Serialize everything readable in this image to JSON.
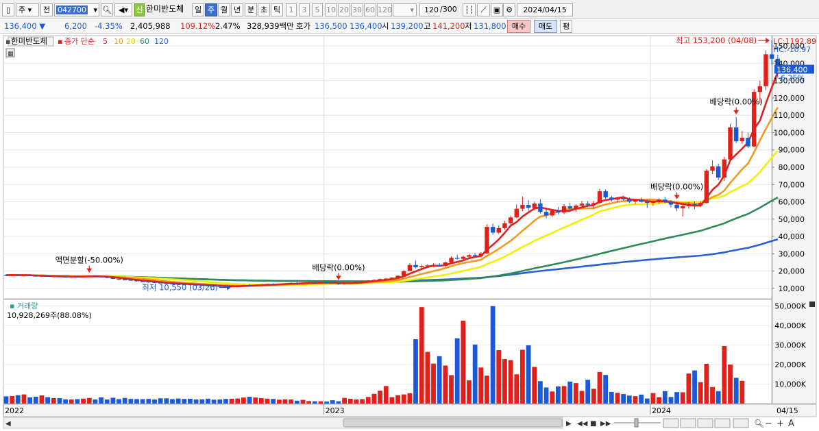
{
  "toolbar": {
    "market_label": "주",
    "prev_label": "전",
    "code": "042700",
    "badge": "신",
    "name": "한미반도체",
    "periods": [
      "일",
      "주",
      "월",
      "년",
      "분",
      "초",
      "틱"
    ],
    "active_period": "주",
    "intervals": [
      "1",
      "3",
      "5",
      "10",
      "20",
      "30",
      "60",
      "120"
    ],
    "count": "120",
    "count_total": "/300",
    "date": "2024/04/15"
  },
  "quote": {
    "price": "136,400",
    "change": "6,200",
    "change_pct": "-4.35%",
    "volume": "2,405,988",
    "volume_ratio": "109.12%",
    "turnover": "2.47%",
    "amount": "328,939백만",
    "ask_label": "호가",
    "ask1": "136,500",
    "ask2": "136,400",
    "open_label": "시",
    "open": "139,200",
    "high_label": "고",
    "high": "141,200",
    "low_label": "저",
    "low": "131,800",
    "buy_button": "매수",
    "sell_button": "매도",
    "eval_button": "평"
  },
  "colors": {
    "up": "#e0201b",
    "down": "#1a5ad8",
    "ma5": "#e0201b",
    "ma10": "#f19a22",
    "ma20": "#f0f000",
    "ma60": "#2e8b57",
    "ma120": "#2c5fd6"
  },
  "chart_data": {
    "type": "candlestick",
    "legend": {
      "title": "한미반도체",
      "ma_label": "종가 단순",
      "periods": [
        "5",
        "10",
        "20",
        "60",
        "120"
      ]
    },
    "lc_label": "LC:1192.89",
    "hc_label": "HC:-10.97",
    "y_ticks": [
      "150,000",
      "140,000",
      "130,000",
      "120,000",
      "110,000",
      "100,000",
      "90,000",
      "80,000",
      "70,000",
      "60,000",
      "50,000",
      "40,000",
      "30,000",
      "20,000",
      "10,000"
    ],
    "ylim": [
      4000,
      156000
    ],
    "current_price": "136,400",
    "current_pct": "-6.25%",
    "x_labels": [
      "2022",
      "2023",
      "2024"
    ],
    "x_last_label": "04/15",
    "annotations": [
      {
        "text": "액면분할(-50.00%)",
        "index": 14
      },
      {
        "text": "배당락(0.00%)",
        "index": 56
      },
      {
        "text": "배당락(0.00%)",
        "index": 113
      },
      {
        "text": "배당락(0.00%)",
        "index": 123
      }
    ],
    "high_note": "최고 153,200 (04/08)",
    "low_note": "최저 10,550 (03/26)",
    "candles": [
      [
        17800,
        18200,
        17100,
        17600
      ],
      [
        17600,
        18000,
        17000,
        17900
      ],
      [
        17900,
        18300,
        17200,
        17400
      ],
      [
        17400,
        17900,
        16900,
        17700
      ],
      [
        17700,
        18100,
        17100,
        17300
      ],
      [
        17300,
        17700,
        16600,
        16900
      ],
      [
        16900,
        17400,
        16500,
        17200
      ],
      [
        17200,
        17500,
        16700,
        16800
      ],
      [
        16800,
        17300,
        16400,
        17000
      ],
      [
        17000,
        17300,
        16500,
        16700
      ],
      [
        16700,
        17200,
        16300,
        16500
      ],
      [
        16500,
        17000,
        16100,
        16900
      ],
      [
        16900,
        17400,
        16400,
        16800
      ],
      [
        16800,
        17200,
        16300,
        17100
      ],
      [
        17100,
        17600,
        16700,
        17200
      ],
      [
        17200,
        17500,
        16600,
        16900
      ],
      [
        16900,
        17200,
        16200,
        16500
      ],
      [
        16500,
        16900,
        15800,
        16100
      ],
      [
        16100,
        16500,
        15300,
        15500
      ],
      [
        15500,
        15900,
        14900,
        15200
      ],
      [
        15200,
        15600,
        14600,
        14900
      ],
      [
        14900,
        15300,
        14400,
        14700
      ],
      [
        14700,
        15000,
        13900,
        14100
      ],
      [
        14100,
        14500,
        13600,
        13900
      ],
      [
        13900,
        14300,
        13300,
        13600
      ],
      [
        13600,
        14000,
        13000,
        13300
      ],
      [
        13300,
        13700,
        12700,
        13000
      ],
      [
        13000,
        13400,
        12500,
        12800
      ],
      [
        12800,
        13100,
        12300,
        12600
      ],
      [
        12600,
        13000,
        12100,
        12400
      ],
      [
        12400,
        12800,
        11900,
        12300
      ],
      [
        12300,
        12700,
        11800,
        12100
      ],
      [
        12100,
        12500,
        11600,
        11900
      ],
      [
        11900,
        12300,
        11400,
        11700
      ],
      [
        11700,
        12100,
        11200,
        11500
      ],
      [
        11500,
        11900,
        11000,
        11300
      ],
      [
        11300,
        11700,
        10800,
        11100
      ],
      [
        11100,
        11500,
        10600,
        10900
      ],
      [
        10900,
        11400,
        10550,
        11200
      ],
      [
        11200,
        11800,
        10900,
        11600
      ],
      [
        11600,
        12100,
        11200,
        11900
      ],
      [
        11900,
        12400,
        11400,
        11700
      ],
      [
        11700,
        12200,
        11200,
        12000
      ],
      [
        12000,
        12500,
        11600,
        12200
      ],
      [
        12200,
        12700,
        11800,
        12500
      ],
      [
        12500,
        13000,
        12000,
        12300
      ],
      [
        12300,
        12800,
        11900,
        12600
      ],
      [
        12600,
        13100,
        12200,
        12900
      ],
      [
        12900,
        13400,
        12500,
        13100
      ],
      [
        13100,
        13600,
        12700,
        12900
      ],
      [
        12900,
        13400,
        12500,
        13200
      ],
      [
        13200,
        13700,
        12800,
        13400
      ],
      [
        13400,
        13900,
        13000,
        13200
      ],
      [
        13200,
        13700,
        12700,
        13500
      ],
      [
        13500,
        14000,
        13100,
        13300
      ],
      [
        13300,
        13700,
        12800,
        12900
      ],
      [
        12900,
        13300,
        12100,
        12600
      ],
      [
        12600,
        13200,
        12200,
        13000
      ],
      [
        13000,
        13600,
        12600,
        13400
      ],
      [
        13400,
        14000,
        13000,
        13800
      ],
      [
        13800,
        14300,
        13400,
        14100
      ],
      [
        14100,
        14800,
        13800,
        14600
      ],
      [
        14600,
        15200,
        14200,
        14900
      ],
      [
        14900,
        15600,
        14600,
        15400
      ],
      [
        15400,
        16000,
        15000,
        15700
      ],
      [
        15700,
        16500,
        15300,
        16200
      ],
      [
        16200,
        17500,
        16000,
        17300
      ],
      [
        17300,
        20500,
        17000,
        20000
      ],
      [
        20000,
        24500,
        19800,
        23500
      ],
      [
        23500,
        26000,
        21500,
        22200
      ],
      [
        22200,
        23800,
        21000,
        22900
      ],
      [
        22900,
        24000,
        21800,
        23300
      ],
      [
        23300,
        24500,
        22300,
        23600
      ],
      [
        23600,
        24600,
        22500,
        22900
      ],
      [
        22900,
        25500,
        22400,
        25000
      ],
      [
        25000,
        28500,
        24800,
        27600
      ],
      [
        27600,
        29500,
        26500,
        27100
      ],
      [
        27100,
        29000,
        26200,
        28300
      ],
      [
        28300,
        30000,
        27500,
        29200
      ],
      [
        29200,
        30500,
        28100,
        28600
      ],
      [
        28600,
        31000,
        28000,
        30200
      ],
      [
        30200,
        47000,
        30000,
        45500
      ],
      [
        45500,
        47500,
        41000,
        42200
      ],
      [
        42200,
        46500,
        41300,
        44800
      ],
      [
        44800,
        49000,
        43900,
        47600
      ],
      [
        47600,
        52000,
        46200,
        51000
      ],
      [
        51000,
        58500,
        50500,
        56000
      ],
      [
        56000,
        63000,
        54500,
        58200
      ],
      [
        58200,
        61000,
        54800,
        56500
      ],
      [
        56500,
        60000,
        55000,
        59000
      ],
      [
        59000,
        61500,
        53200,
        54200
      ],
      [
        54200,
        56000,
        50500,
        52100
      ],
      [
        52100,
        55800,
        51300,
        54900
      ],
      [
        54900,
        57000,
        52700,
        53800
      ],
      [
        53800,
        58700,
        52900,
        57400
      ],
      [
        57400,
        59500,
        55000,
        56100
      ],
      [
        56100,
        58500,
        54200,
        57800
      ],
      [
        57800,
        60500,
        56800,
        59000
      ],
      [
        59000,
        60500,
        57100,
        58300
      ],
      [
        58300,
        60500,
        56000,
        59300
      ],
      [
        59300,
        67500,
        58800,
        66100
      ],
      [
        66100,
        67200,
        61800,
        62500
      ],
      [
        62500,
        63500,
        60300,
        61200
      ],
      [
        61200,
        62800,
        59800,
        62100
      ],
      [
        62100,
        63500,
        60900,
        61400
      ],
      [
        61400,
        62500,
        59200,
        60100
      ],
      [
        60100,
        61600,
        58700,
        61000
      ],
      [
        61000,
        62500,
        59600,
        60000
      ],
      [
        60000,
        61200,
        56500,
        59400
      ],
      [
        59400,
        60800,
        57600,
        59900
      ],
      [
        59900,
        62000,
        58700,
        61300
      ],
      [
        61300,
        62700,
        59200,
        60100
      ],
      [
        60100,
        61000,
        56800,
        58400
      ],
      [
        58400,
        60000,
        54500,
        56200
      ],
      [
        56200,
        58400,
        51500,
        57500
      ],
      [
        57500,
        60000,
        56000,
        58700
      ],
      [
        58700,
        60200,
        55800,
        57900
      ],
      [
        57900,
        60300,
        57000,
        59300
      ],
      [
        59300,
        79000,
        59000,
        78000
      ],
      [
        78000,
        84000,
        76000,
        80500
      ],
      [
        80500,
        82000,
        72500,
        74000
      ],
      [
        74000,
        86000,
        72000,
        84500
      ],
      [
        84500,
        105000,
        83000,
        103000
      ],
      [
        103000,
        109000,
        94000,
        95000
      ],
      [
        95000,
        101000,
        93500,
        97000
      ],
      [
        97000,
        100000,
        91000,
        92000
      ],
      [
        92000,
        125000,
        91500,
        123500
      ],
      [
        123500,
        130000,
        117000,
        126800
      ],
      [
        126800,
        147500,
        124500,
        145200
      ],
      [
        145200,
        153200,
        139000,
        142600
      ],
      [
        142600,
        145000,
        131800,
        136400
      ]
    ],
    "volumes": [
      3.7,
      3.9,
      4.3,
      4.7,
      3.2,
      3.5,
      4.2,
      3.3,
      2.8,
      2.8,
      2.2,
      2.1,
      2.3,
      2.5,
      2.9,
      2.1,
      3.2,
      2.1,
      3.0,
      2.3,
      2.9,
      2.4,
      2.3,
      2.3,
      2.4,
      2.1,
      2.7,
      2.7,
      2.3,
      2.6,
      2.4,
      2.5,
      2.1,
      2.2,
      2.5,
      2.0,
      2.1,
      2.4,
      2.5,
      2.6,
      3.1,
      3.5,
      3.1,
      2.8,
      2.5,
      2.4,
      2.0,
      2.2,
      2.1,
      1.5,
      1.9,
      1.3,
      1.2,
      1.2,
      1.1,
      1.7,
      1.2,
      2.9,
      2.5,
      2.1,
      2.3,
      3.4,
      5.0,
      6.6,
      9.0,
      3.3,
      4.3,
      4.7,
      5.3,
      33.0,
      49.5,
      26.5,
      20.5,
      24.3,
      19.5,
      14.6,
      33.5,
      42.5,
      11.9,
      30.3,
      18.5,
      14.3,
      50.0,
      27.4,
      22.8,
      22.3,
      15.0,
      27.6,
      29.9,
      18.8,
      11.5,
      8.3,
      6.2,
      8.8,
      9.0,
      11.3,
      10.5,
      6.5,
      12.2,
      7.6,
      16.2,
      14.7,
      6.0,
      5.5,
      4.9,
      4.1,
      3.8,
      4.6,
      2.6,
      5.4,
      3.3,
      6.4,
      3.4,
      5.9,
      5.8,
      15.4,
      17.0,
      11.0,
      20.4,
      8.5,
      6.4,
      29.5,
      20.0,
      13.2,
      11.7
    ],
    "vol_ticks": [
      "50,000K",
      "40,000K",
      "30,000K",
      "20,000K",
      "10,000K"
    ],
    "vol_ylim": [
      0,
      52
    ],
    "vol_label": "거래량",
    "vol_summary": "10,928,269주(88.08%)",
    "vol_current": "10,928K",
    "vol_current_pct": "88.08%"
  }
}
